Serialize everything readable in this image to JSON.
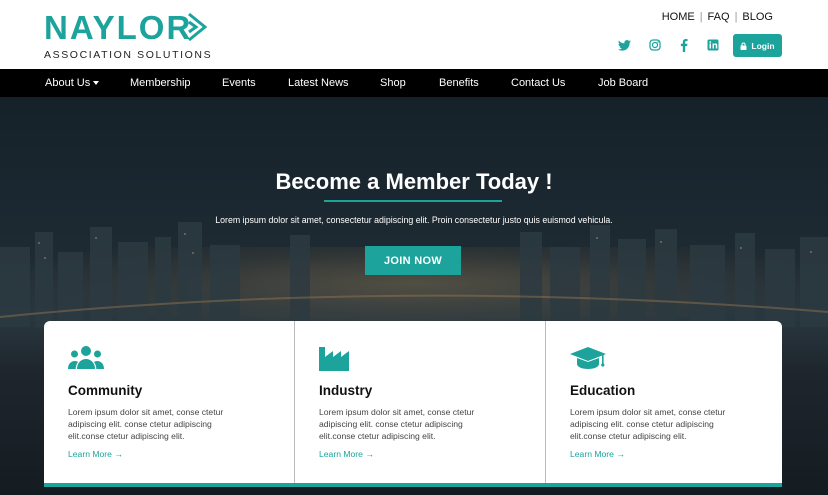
{
  "brand": {
    "name": "NAYLOR",
    "tagline": "ASSOCIATION SOLUTIONS",
    "color": "#1ba39c"
  },
  "utility": {
    "home": "HOME",
    "faq": "FAQ",
    "blog": "BLOG",
    "separator": "|"
  },
  "social": [
    "twitter-icon",
    "instagram-icon",
    "facebook-icon",
    "linkedin-icon"
  ],
  "login": {
    "label": "Login",
    "icon": "lock-icon"
  },
  "nav": {
    "items": [
      {
        "label": "About Us",
        "has_dropdown": true
      },
      {
        "label": "Membership"
      },
      {
        "label": "Events"
      },
      {
        "label": "Latest News"
      },
      {
        "label": "Shop"
      },
      {
        "label": "Benefits"
      },
      {
        "label": "Contact Us"
      },
      {
        "label": "Job Board"
      }
    ]
  },
  "hero": {
    "title": "Become a Member Today !",
    "text": "Lorem ipsum dolor sit amet, consectetur adipiscing elit. Proin consectetur justo quis euismod vehicula.",
    "cta": "JOIN NOW"
  },
  "cards": [
    {
      "icon": "users-icon",
      "title": "Community",
      "text": "Lorem ipsum dolor sit amet, conse ctetur adipiscing elit. conse ctetur adipiscing elit.conse ctetur adipiscing elit.",
      "link": "Learn More →"
    },
    {
      "icon": "factory-icon",
      "title": "Industry",
      "text": "Lorem ipsum dolor sit amet, conse ctetur adipiscing elit. conse ctetur adipiscing elit.conse ctetur adipiscing elit.",
      "link": "Learn More →"
    },
    {
      "icon": "graduation-cap-icon",
      "title": "Education",
      "text": "Lorem ipsum dolor sit amet, conse ctetur adipiscing elit. conse ctetur adipiscing elit.conse ctetur adipiscing elit.",
      "link": "Learn More →"
    }
  ]
}
